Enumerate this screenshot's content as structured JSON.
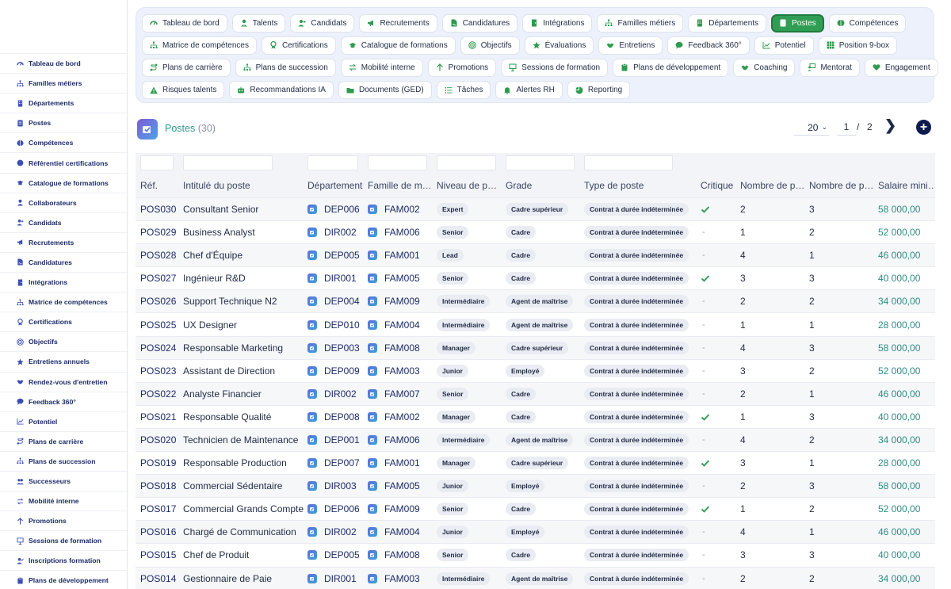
{
  "sidebar": {
    "items": [
      {
        "label": "Tableau de bord",
        "icon": "dashboard-icon"
      },
      {
        "label": "Familles métiers",
        "icon": "hierarchy-icon"
      },
      {
        "label": "Départements",
        "icon": "building-icon"
      },
      {
        "label": "Postes",
        "icon": "id-card-icon"
      },
      {
        "label": "Compétences",
        "icon": "brain-icon"
      },
      {
        "label": "Référentiel certifications",
        "icon": "certificate-icon"
      },
      {
        "label": "Catalogue de formations",
        "icon": "graduation-cap-icon"
      },
      {
        "label": "Collaborateurs",
        "icon": "user-icon"
      },
      {
        "label": "Candidats",
        "icon": "user-plus-icon"
      },
      {
        "label": "Recrutements",
        "icon": "megaphone-icon"
      },
      {
        "label": "Candidatures",
        "icon": "file-signature-icon"
      },
      {
        "label": "Intégrations",
        "icon": "door-icon"
      },
      {
        "label": "Matrice de compétences",
        "icon": "hierarchy-icon"
      },
      {
        "label": "Certifications",
        "icon": "award-icon"
      },
      {
        "label": "Objectifs",
        "icon": "target-icon"
      },
      {
        "label": "Entretiens annuels",
        "icon": "star-icon"
      },
      {
        "label": "Rendez-vous d'entretien",
        "icon": "handshake-icon"
      },
      {
        "label": "Feedback 360°",
        "icon": "comment-icon"
      },
      {
        "label": "Potentiel",
        "icon": "chart-line-icon"
      },
      {
        "label": "Plans de carrière",
        "icon": "route-icon"
      },
      {
        "label": "Plans de succession",
        "icon": "hierarchy-icon"
      },
      {
        "label": "Successeurs",
        "icon": "users-icon"
      },
      {
        "label": "Mobilité interne",
        "icon": "exchange-icon"
      },
      {
        "label": "Promotions",
        "icon": "arrow-up-icon"
      },
      {
        "label": "Sessions de formation",
        "icon": "presentation-icon"
      },
      {
        "label": "Inscriptions formation",
        "icon": "user-check-icon"
      },
      {
        "label": "Plans de développement",
        "icon": "clipboard-icon"
      }
    ]
  },
  "topnav": {
    "rows": [
      [
        {
          "label": "Tableau de bord",
          "icon": "dashboard-icon",
          "active": false
        },
        {
          "label": "Talents",
          "icon": "user-tie-icon",
          "active": false
        },
        {
          "label": "Candidats",
          "icon": "user-plus-icon",
          "active": false
        },
        {
          "label": "Recrutements",
          "icon": "megaphone-icon",
          "active": false
        },
        {
          "label": "Candidatures",
          "icon": "file-signature-icon",
          "active": false
        },
        {
          "label": "Intégrations",
          "icon": "door-icon",
          "active": false
        },
        {
          "label": "Familles métiers",
          "icon": "hierarchy-icon",
          "active": false
        },
        {
          "label": "Départements",
          "icon": "building-icon",
          "active": false
        },
        {
          "label": "Postes",
          "icon": "id-card-icon",
          "active": true
        },
        {
          "label": "Compétences",
          "icon": "brain-icon",
          "active": false
        }
      ],
      [
        {
          "label": "Matrice de compétences",
          "icon": "hierarchy-icon",
          "active": false
        },
        {
          "label": "Certifications",
          "icon": "award-icon",
          "active": false
        },
        {
          "label": "Catalogue de formations",
          "icon": "graduation-cap-icon",
          "active": false
        },
        {
          "label": "Objectifs",
          "icon": "target-icon",
          "active": false
        },
        {
          "label": "Évaluations",
          "icon": "star-icon",
          "active": false
        },
        {
          "label": "Entretiens",
          "icon": "handshake-icon",
          "active": false
        },
        {
          "label": "Feedback 360°",
          "icon": "comment-icon",
          "active": false
        },
        {
          "label": "Potentiel",
          "icon": "chart-line-icon",
          "active": false
        },
        {
          "label": "Position 9-box",
          "icon": "grid-icon",
          "active": false
        }
      ],
      [
        {
          "label": "Plans de carrière",
          "icon": "route-icon",
          "active": false
        },
        {
          "label": "Plans de succession",
          "icon": "hierarchy-icon",
          "active": false
        },
        {
          "label": "Mobilité interne",
          "icon": "exchange-icon",
          "active": false
        },
        {
          "label": "Promotions",
          "icon": "arrow-up-icon",
          "active": false
        },
        {
          "label": "Sessions de formation",
          "icon": "presentation-icon",
          "active": false
        },
        {
          "label": "Plans de développement",
          "icon": "clipboard-icon",
          "active": false
        },
        {
          "label": "Coaching",
          "icon": "handshake-icon",
          "active": false
        },
        {
          "label": "Mentorat",
          "icon": "chalkboard-user-icon",
          "active": false
        },
        {
          "label": "Engagement",
          "icon": "heart-icon",
          "active": false
        }
      ],
      [
        {
          "label": "Risques talents",
          "icon": "warning-icon",
          "active": false
        },
        {
          "label": "Recommandations IA",
          "icon": "robot-icon",
          "active": false
        },
        {
          "label": "Documents (GED)",
          "icon": "folder-icon",
          "active": false
        },
        {
          "label": "Tâches",
          "icon": "list-icon",
          "active": false
        },
        {
          "label": "Alertes RH",
          "icon": "bell-icon",
          "active": false
        },
        {
          "label": "Reporting",
          "icon": "pie-chart-icon",
          "active": false
        }
      ]
    ]
  },
  "header": {
    "title": "Postes",
    "count": "(30)",
    "page_size": "20",
    "current_page": "1",
    "separator": "/",
    "total_pages": "2",
    "next": "❯",
    "add": "+"
  },
  "columns": [
    "Réf.",
    "Intitulé du poste",
    "Département",
    "Famille de m…",
    "Niveau de p…",
    "Grade",
    "Type de poste",
    "Critique",
    "Nombre de p…",
    "Nombre de p…",
    "Salaire mini…"
  ],
  "rows": [
    {
      "ref": "POS030",
      "title": "Consultant Senior",
      "dept": "DEP006",
      "family": "FAM002",
      "level": "Expert",
      "grade": "Cadre supérieur",
      "type": "Contrat à durée indéterminée",
      "critical": true,
      "n1": "2",
      "n2": "3",
      "salary": "58 000,00"
    },
    {
      "ref": "POS029",
      "title": "Business Analyst",
      "dept": "DIR002",
      "family": "FAM006",
      "level": "Senior",
      "grade": "Cadre",
      "type": "Contrat à durée indéterminée",
      "critical": false,
      "n1": "1",
      "n2": "2",
      "salary": "52 000,00"
    },
    {
      "ref": "POS028",
      "title": "Chef d'Équipe",
      "dept": "DEP005",
      "family": "FAM001",
      "level": "Lead",
      "grade": "Cadre",
      "type": "Contrat à durée indéterminée",
      "critical": false,
      "n1": "4",
      "n2": "1",
      "salary": "46 000,00"
    },
    {
      "ref": "POS027",
      "title": "Ingénieur R&D",
      "dept": "DIR001",
      "family": "FAM005",
      "level": "Senior",
      "grade": "Cadre",
      "type": "Contrat à durée indéterminée",
      "critical": true,
      "n1": "3",
      "n2": "3",
      "salary": "40 000,00"
    },
    {
      "ref": "POS026",
      "title": "Support Technique N2",
      "dept": "DEP004",
      "family": "FAM009",
      "level": "Intermédiaire",
      "grade": "Agent de maîtrise",
      "type": "Contrat à durée indéterminée",
      "critical": false,
      "n1": "2",
      "n2": "2",
      "salary": "34 000,00"
    },
    {
      "ref": "POS025",
      "title": "UX Designer",
      "dept": "DEP010",
      "family": "FAM004",
      "level": "Intermédiaire",
      "grade": "Agent de maîtrise",
      "type": "Contrat à durée indéterminée",
      "critical": false,
      "n1": "1",
      "n2": "1",
      "salary": "28 000,00"
    },
    {
      "ref": "POS024",
      "title": "Responsable Marketing",
      "dept": "DEP003",
      "family": "FAM008",
      "level": "Manager",
      "grade": "Cadre supérieur",
      "type": "Contrat à durée indéterminée",
      "critical": false,
      "n1": "4",
      "n2": "3",
      "salary": "58 000,00"
    },
    {
      "ref": "POS023",
      "title": "Assistant de Direction",
      "dept": "DEP009",
      "family": "FAM003",
      "level": "Junior",
      "grade": "Employé",
      "type": "Contrat à durée indéterminée",
      "critical": false,
      "n1": "3",
      "n2": "2",
      "salary": "52 000,00"
    },
    {
      "ref": "POS022",
      "title": "Analyste Financier",
      "dept": "DIR002",
      "family": "FAM007",
      "level": "Senior",
      "grade": "Cadre",
      "type": "Contrat à durée indéterminée",
      "critical": false,
      "n1": "2",
      "n2": "1",
      "salary": "46 000,00"
    },
    {
      "ref": "POS021",
      "title": "Responsable Qualité",
      "dept": "DEP008",
      "family": "FAM002",
      "level": "Manager",
      "grade": "Cadre",
      "type": "Contrat à durée indéterminée",
      "critical": true,
      "n1": "1",
      "n2": "3",
      "salary": "40 000,00"
    },
    {
      "ref": "POS020",
      "title": "Technicien de Maintenance",
      "dept": "DEP001",
      "family": "FAM006",
      "level": "Intermédiaire",
      "grade": "Agent de maîtrise",
      "type": "Contrat à durée indéterminée",
      "critical": false,
      "n1": "4",
      "n2": "2",
      "salary": "34 000,00"
    },
    {
      "ref": "POS019",
      "title": "Responsable Production",
      "dept": "DEP007",
      "family": "FAM001",
      "level": "Manager",
      "grade": "Cadre supérieur",
      "type": "Contrat à durée indéterminée",
      "critical": true,
      "n1": "3",
      "n2": "1",
      "salary": "28 000,00"
    },
    {
      "ref": "POS018",
      "title": "Commercial Sédentaire",
      "dept": "DIR003",
      "family": "FAM005",
      "level": "Junior",
      "grade": "Employé",
      "type": "Contrat à durée indéterminée",
      "critical": false,
      "n1": "2",
      "n2": "3",
      "salary": "58 000,00"
    },
    {
      "ref": "POS017",
      "title": "Commercial Grands Comptes",
      "dept": "DEP006",
      "family": "FAM009",
      "level": "Senior",
      "grade": "Cadre",
      "type": "Contrat à durée indéterminée",
      "critical": true,
      "n1": "1",
      "n2": "2",
      "salary": "52 000,00"
    },
    {
      "ref": "POS016",
      "title": "Chargé de Communication",
      "dept": "DIR002",
      "family": "FAM004",
      "level": "Junior",
      "grade": "Employé",
      "type": "Contrat à durée indéterminée",
      "critical": false,
      "n1": "4",
      "n2": "1",
      "salary": "46 000,00"
    },
    {
      "ref": "POS015",
      "title": "Chef de Produit",
      "dept": "DEP005",
      "family": "FAM008",
      "level": "Senior",
      "grade": "Cadre",
      "type": "Contrat à durée indéterminée",
      "critical": false,
      "n1": "3",
      "n2": "3",
      "salary": "40 000,00"
    },
    {
      "ref": "POS014",
      "title": "Gestionnaire de Paie",
      "dept": "DIR001",
      "family": "FAM003",
      "level": "Intermédiaire",
      "grade": "Agent de maîtrise",
      "type": "Contrat à durée indéterminée",
      "critical": false,
      "n1": "2",
      "n2": "2",
      "salary": "34 000,00"
    }
  ],
  "colors": {
    "accent": "#2f9e54",
    "title": "#2e9a8f",
    "salary": "#2e8a86",
    "navy": "#1c2b66"
  }
}
